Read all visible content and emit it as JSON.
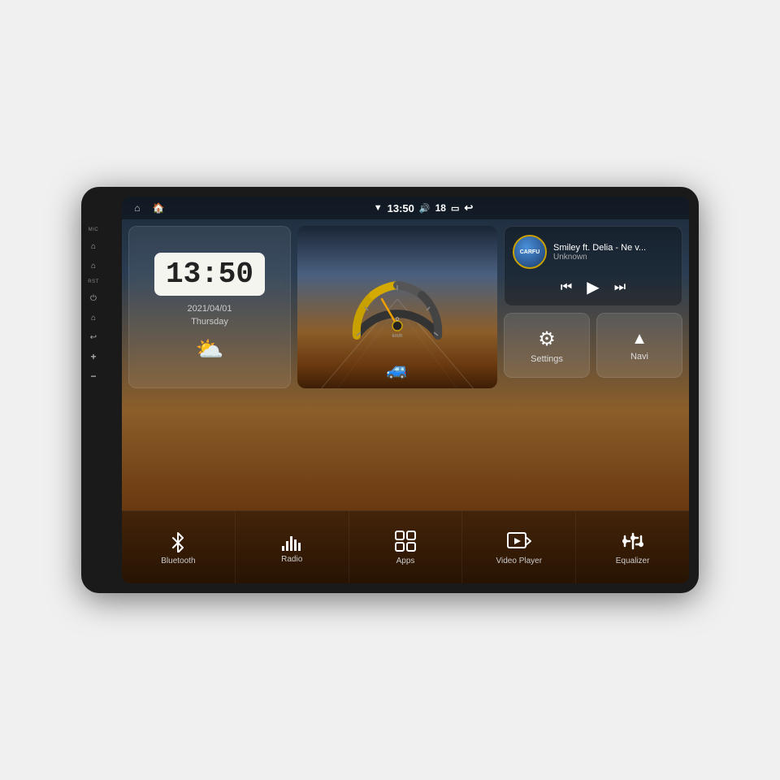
{
  "device": {
    "outer_bg": "#1a1a1a",
    "screen_border_radius": "10px"
  },
  "status_bar": {
    "time": "13:50",
    "volume": "18",
    "wifi_icon": "▼",
    "volume_icon": "🔊",
    "battery_icon": "🔋",
    "back_icon": "↩",
    "home_icon": "⌂",
    "recent_icon": "◻"
  },
  "side_buttons": {
    "mic_label": "MIC",
    "rst_label": "RST",
    "power_icon": "⏻",
    "home_icon": "⌂",
    "back_icon": "↩",
    "vol_up_icon": "＋",
    "vol_down_icon": "－"
  },
  "clock": {
    "time": "13:50",
    "date": "2021/04/01",
    "day": "Thursday",
    "weather_icon": "⛅"
  },
  "music": {
    "logo_text": "CARFU",
    "title": "Smiley ft. Delia - Ne v...",
    "artist": "Unknown",
    "prev_icon": "⏮",
    "play_icon": "▶",
    "next_icon": "⏭"
  },
  "quick_buttons": [
    {
      "id": "settings",
      "label": "Settings",
      "icon": "⚙"
    },
    {
      "id": "navi",
      "label": "Navi",
      "icon": "◬"
    }
  ],
  "app_bar": [
    {
      "id": "bluetooth",
      "label": "Bluetooth",
      "icon": "bluetooth"
    },
    {
      "id": "radio",
      "label": "Radio",
      "icon": "radio"
    },
    {
      "id": "apps",
      "label": "Apps",
      "icon": "apps"
    },
    {
      "id": "video",
      "label": "Video Player",
      "icon": "video"
    },
    {
      "id": "equalizer",
      "label": "Equalizer",
      "icon": "equalizer"
    }
  ],
  "speedometer": {
    "value": "0",
    "unit": "km/h",
    "max": "240"
  }
}
